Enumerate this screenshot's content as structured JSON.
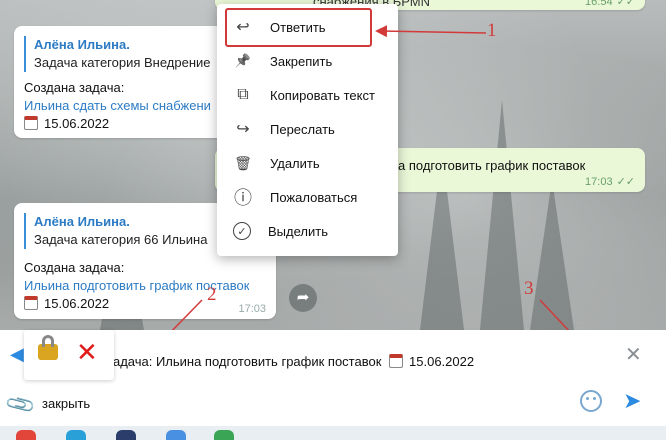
{
  "messages": [
    {
      "author": "Алёна Ильина.",
      "quote": "Задача категория Внедрение",
      "created_label": "Создана задача:",
      "task_link": "Ильина сдать схемы снабжени",
      "date": "15.06.2022"
    },
    {
      "author": "Алёна Ильина.",
      "quote": "Задача категория 66 Ильина",
      "created_label": "Создана задача:",
      "task_link": "Ильина подготовить график поставок",
      "date": "15.06.2022",
      "time": "17:03"
    }
  ],
  "outgoing": [
    {
      "text": "снабжения в БРМN",
      "time": "16:54",
      "ticks": "✓✓"
    },
    {
      "text": "а подготовить график поставок",
      "time": "17:03",
      "ticks": "✓✓"
    }
  ],
  "context_menu": {
    "items": [
      {
        "label": "Ответить",
        "icon": "reply-icon",
        "glyph": "↩"
      },
      {
        "label": "Закрепить",
        "icon": "pin-icon",
        "glyph": "📌"
      },
      {
        "label": "Копировать текст",
        "icon": "copy-icon",
        "glyph": "⧉"
      },
      {
        "label": "Переслать",
        "icon": "forward-icon",
        "glyph": "↪"
      },
      {
        "label": "Удалить",
        "icon": "trash-icon",
        "glyph": "🗑"
      },
      {
        "label": "Пожаловаться",
        "icon": "report-icon",
        "glyph": "ⓘ"
      },
      {
        "label": "Выделить",
        "icon": "select-check-icon",
        "glyph": "✓"
      }
    ]
  },
  "annotations": {
    "one": "1",
    "two": "2",
    "three": "3"
  },
  "reply": {
    "text": "задача: Ильина подготовить график поставок",
    "date": "15.06.2022"
  },
  "composer": {
    "value": "закрыть"
  },
  "colors": {
    "accent": "#2c8ae0",
    "annotation": "#d23a3a",
    "outgoing_bg": "#eaf8d8"
  }
}
